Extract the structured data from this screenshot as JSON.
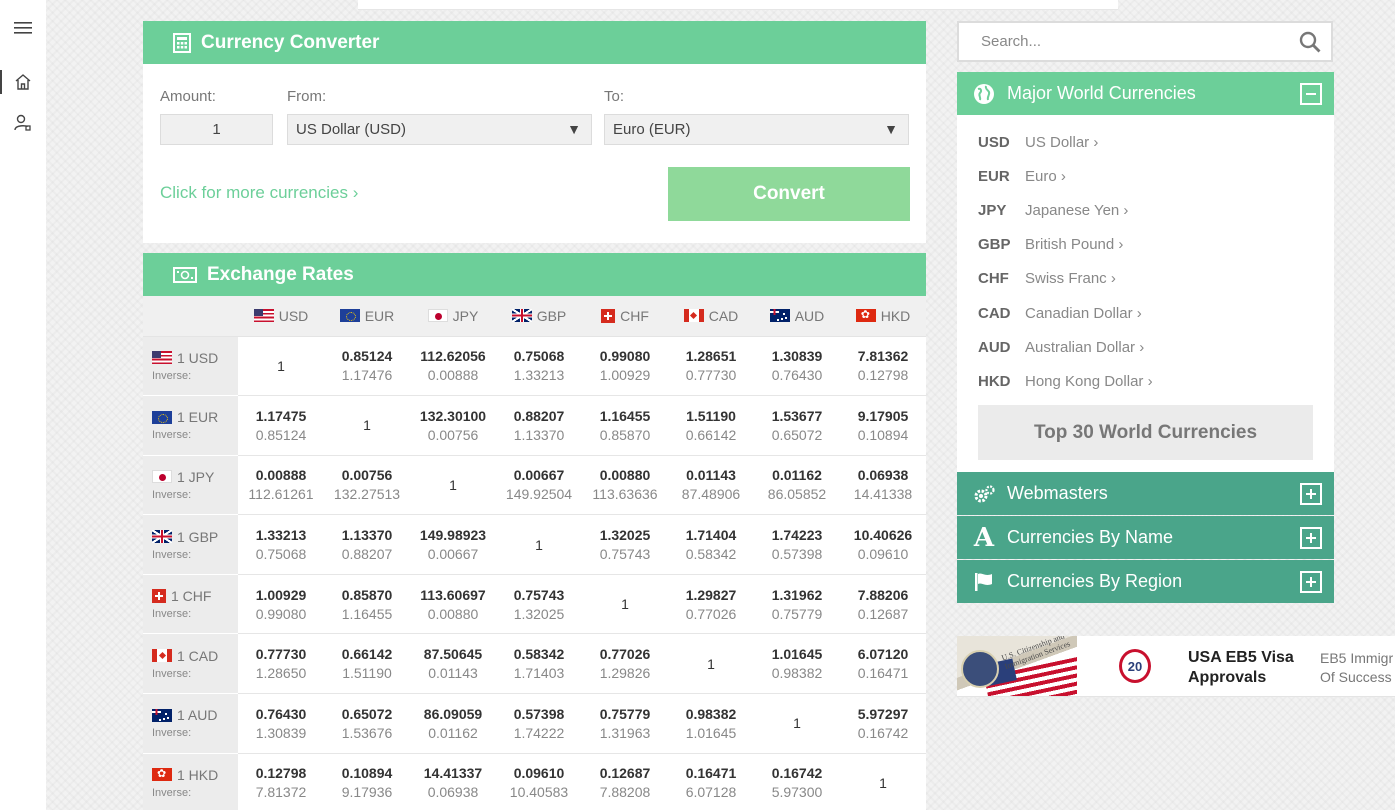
{
  "converter": {
    "title": "Currency Converter",
    "amount_label": "Amount:",
    "amount_value": "1",
    "from_label": "From:",
    "from_value": "US Dollar (USD)",
    "to_label": "To:",
    "to_value": "Euro (EUR)",
    "more_link": "Click for more currencies ›",
    "convert_label": "Convert"
  },
  "rates": {
    "title": "Exchange Rates",
    "inverse_label": "Inverse:",
    "currencies": [
      "USD",
      "EUR",
      "JPY",
      "GBP",
      "CHF",
      "CAD",
      "AUD",
      "HKD"
    ],
    "rows": [
      {
        "label": "1 USD",
        "flag": "usd",
        "cells": [
          {
            "one": "1"
          },
          {
            "v": "0.85124",
            "i": "1.17476"
          },
          {
            "v": "112.62056",
            "i": "0.00888"
          },
          {
            "v": "0.75068",
            "i": "1.33213"
          },
          {
            "v": "0.99080",
            "i": "1.00929"
          },
          {
            "v": "1.28651",
            "i": "0.77730"
          },
          {
            "v": "1.30839",
            "i": "0.76430"
          },
          {
            "v": "7.81362",
            "i": "0.12798"
          }
        ]
      },
      {
        "label": "1 EUR",
        "flag": "eur",
        "cells": [
          {
            "v": "1.17475",
            "i": "0.85124"
          },
          {
            "one": "1"
          },
          {
            "v": "132.30100",
            "i": "0.00756"
          },
          {
            "v": "0.88207",
            "i": "1.13370"
          },
          {
            "v": "1.16455",
            "i": "0.85870"
          },
          {
            "v": "1.51190",
            "i": "0.66142"
          },
          {
            "v": "1.53677",
            "i": "0.65072"
          },
          {
            "v": "9.17905",
            "i": "0.10894"
          }
        ]
      },
      {
        "label": "1 JPY",
        "flag": "jpy",
        "cells": [
          {
            "v": "0.00888",
            "i": "112.61261"
          },
          {
            "v": "0.00756",
            "i": "132.27513"
          },
          {
            "one": "1"
          },
          {
            "v": "0.00667",
            "i": "149.92504"
          },
          {
            "v": "0.00880",
            "i": "113.63636"
          },
          {
            "v": "0.01143",
            "i": "87.48906"
          },
          {
            "v": "0.01162",
            "i": "86.05852"
          },
          {
            "v": "0.06938",
            "i": "14.41338"
          }
        ]
      },
      {
        "label": "1 GBP",
        "flag": "gbp",
        "cells": [
          {
            "v": "1.33213",
            "i": "0.75068"
          },
          {
            "v": "1.13370",
            "i": "0.88207"
          },
          {
            "v": "149.98923",
            "i": "0.00667"
          },
          {
            "one": "1"
          },
          {
            "v": "1.32025",
            "i": "0.75743"
          },
          {
            "v": "1.71404",
            "i": "0.58342"
          },
          {
            "v": "1.74223",
            "i": "0.57398"
          },
          {
            "v": "10.40626",
            "i": "0.09610"
          }
        ]
      },
      {
        "label": "1 CHF",
        "flag": "chf",
        "cells": [
          {
            "v": "1.00929",
            "i": "0.99080"
          },
          {
            "v": "0.85870",
            "i": "1.16455"
          },
          {
            "v": "113.60697",
            "i": "0.00880"
          },
          {
            "v": "0.75743",
            "i": "1.32025"
          },
          {
            "one": "1"
          },
          {
            "v": "1.29827",
            "i": "0.77026"
          },
          {
            "v": "1.31962",
            "i": "0.75779"
          },
          {
            "v": "7.88206",
            "i": "0.12687"
          }
        ]
      },
      {
        "label": "1 CAD",
        "flag": "cad",
        "cells": [
          {
            "v": "0.77730",
            "i": "1.28650"
          },
          {
            "v": "0.66142",
            "i": "1.51190"
          },
          {
            "v": "87.50645",
            "i": "0.01143"
          },
          {
            "v": "0.58342",
            "i": "1.71403"
          },
          {
            "v": "0.77026",
            "i": "1.29826"
          },
          {
            "one": "1"
          },
          {
            "v": "1.01645",
            "i": "0.98382"
          },
          {
            "v": "6.07120",
            "i": "0.16471"
          }
        ]
      },
      {
        "label": "1 AUD",
        "flag": "aud",
        "cells": [
          {
            "v": "0.76430",
            "i": "1.30839"
          },
          {
            "v": "0.65072",
            "i": "1.53676"
          },
          {
            "v": "86.09059",
            "i": "0.01162"
          },
          {
            "v": "0.57398",
            "i": "1.74222"
          },
          {
            "v": "0.75779",
            "i": "1.31963"
          },
          {
            "v": "0.98382",
            "i": "1.01645"
          },
          {
            "one": "1"
          },
          {
            "v": "5.97297",
            "i": "0.16742"
          }
        ]
      },
      {
        "label": "1 HKD",
        "flag": "hkd",
        "cells": [
          {
            "v": "0.12798",
            "i": "7.81372"
          },
          {
            "v": "0.10894",
            "i": "9.17936"
          },
          {
            "v": "14.41337",
            "i": "0.06938"
          },
          {
            "v": "0.09610",
            "i": "10.40583"
          },
          {
            "v": "0.12687",
            "i": "7.88208"
          },
          {
            "v": "0.16471",
            "i": "6.07128"
          },
          {
            "v": "0.16742",
            "i": "5.97300"
          },
          {
            "one": "1"
          }
        ]
      }
    ]
  },
  "search": {
    "placeholder": "Search..."
  },
  "major": {
    "title": "Major World Currencies",
    "items": [
      {
        "code": "USD",
        "name": "US Dollar ›"
      },
      {
        "code": "EUR",
        "name": "Euro ›"
      },
      {
        "code": "JPY",
        "name": "Japanese Yen ›"
      },
      {
        "code": "GBP",
        "name": "British Pound ›"
      },
      {
        "code": "CHF",
        "name": "Swiss Franc ›"
      },
      {
        "code": "CAD",
        "name": "Canadian Dollar ›"
      },
      {
        "code": "AUD",
        "name": "Australian Dollar ›"
      },
      {
        "code": "HKD",
        "name": "Hong Kong Dollar ›"
      }
    ],
    "top30_label": "Top 30 World Currencies"
  },
  "panels": {
    "webmasters": "Webmasters",
    "by_name": "Currencies By Name",
    "by_region": "Currencies By Region"
  },
  "ad": {
    "image_text": "U.S. Citizenship and Immigration Services",
    "badge": "20",
    "title": "USA EB5 Visa Approvals",
    "desc_line1": "EB5 Immigr",
    "desc_line2": "Of Success"
  },
  "colors": {
    "accent": "#6ccf99",
    "teal": "#4aa58a",
    "convert_button": "#8fd99a"
  }
}
